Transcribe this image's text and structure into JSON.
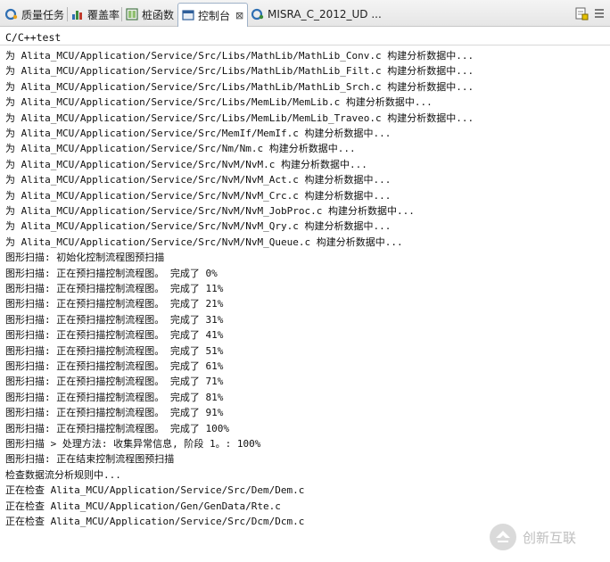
{
  "tabs": [
    {
      "label": "质量任务",
      "icon": "quality-task-icon",
      "active": false
    },
    {
      "label": "覆盖率",
      "icon": "coverage-chart-icon",
      "active": false
    },
    {
      "label": "桩函数",
      "icon": "stub-function-icon",
      "active": false
    },
    {
      "label": "控制台",
      "icon": "console-icon",
      "active": true,
      "close": "⊠"
    },
    {
      "label": "MISRA_C_2012_UD ...",
      "icon": "misra-icon",
      "active": false
    }
  ],
  "toolbar": {
    "icons": [
      "clear-console-icon",
      "view-menu-icon"
    ]
  },
  "console": {
    "title": "C/C++test",
    "lines": [
      "为 Alita_MCU/Application/Service/Src/Libs/MathLib/MathLib_Conv.c 构建分析数据中...",
      "为 Alita_MCU/Application/Service/Src/Libs/MathLib/MathLib_Filt.c 构建分析数据中...",
      "为 Alita_MCU/Application/Service/Src/Libs/MathLib/MathLib_Srch.c 构建分析数据中...",
      "为 Alita_MCU/Application/Service/Src/Libs/MemLib/MemLib.c 构建分析数据中...",
      "为 Alita_MCU/Application/Service/Src/Libs/MemLib/MemLib_Traveo.c 构建分析数据中...",
      "为 Alita_MCU/Application/Service/Src/MemIf/MemIf.c 构建分析数据中...",
      "为 Alita_MCU/Application/Service/Src/Nm/Nm.c 构建分析数据中...",
      "为 Alita_MCU/Application/Service/Src/NvM/NvM.c 构建分析数据中...",
      "为 Alita_MCU/Application/Service/Src/NvM/NvM_Act.c 构建分析数据中...",
      "为 Alita_MCU/Application/Service/Src/NvM/NvM_Crc.c 构建分析数据中...",
      "为 Alita_MCU/Application/Service/Src/NvM/NvM_JobProc.c 构建分析数据中...",
      "为 Alita_MCU/Application/Service/Src/NvM/NvM_Qry.c 构建分析数据中...",
      "为 Alita_MCU/Application/Service/Src/NvM/NvM_Queue.c 构建分析数据中...",
      "图形扫描: 初始化控制流程图预扫描",
      "图形扫描: 正在预扫描控制流程图。 完成了 0%",
      "图形扫描: 正在预扫描控制流程图。 完成了 11%",
      "图形扫描: 正在预扫描控制流程图。 完成了 21%",
      "图形扫描: 正在预扫描控制流程图。 完成了 31%",
      "图形扫描: 正在预扫描控制流程图。 完成了 41%",
      "图形扫描: 正在预扫描控制流程图。 完成了 51%",
      "图形扫描: 正在预扫描控制流程图。 完成了 61%",
      "图形扫描: 正在预扫描控制流程图。 完成了 71%",
      "图形扫描: 正在预扫描控制流程图。 完成了 81%",
      "图形扫描: 正在预扫描控制流程图。 完成了 91%",
      "图形扫描: 正在预扫描控制流程图。 完成了 100%",
      "图形扫描 > 处理方法: 收集异常信息, 阶段 1。: 100%",
      "图形扫描: 正在结束控制流程图预扫描",
      "检查数据流分析规则中...",
      "正在检查 Alita_MCU/Application/Service/Src/Dem/Dem.c",
      "正在检查 Alita_MCU/Application/Gen/GenData/Rte.c",
      "正在检查 Alita_MCU/Application/Service/Src/Dcm/Dcm.c"
    ]
  },
  "watermark": {
    "text": "创新互联",
    "icon": "chuangxin-logo-icon"
  }
}
